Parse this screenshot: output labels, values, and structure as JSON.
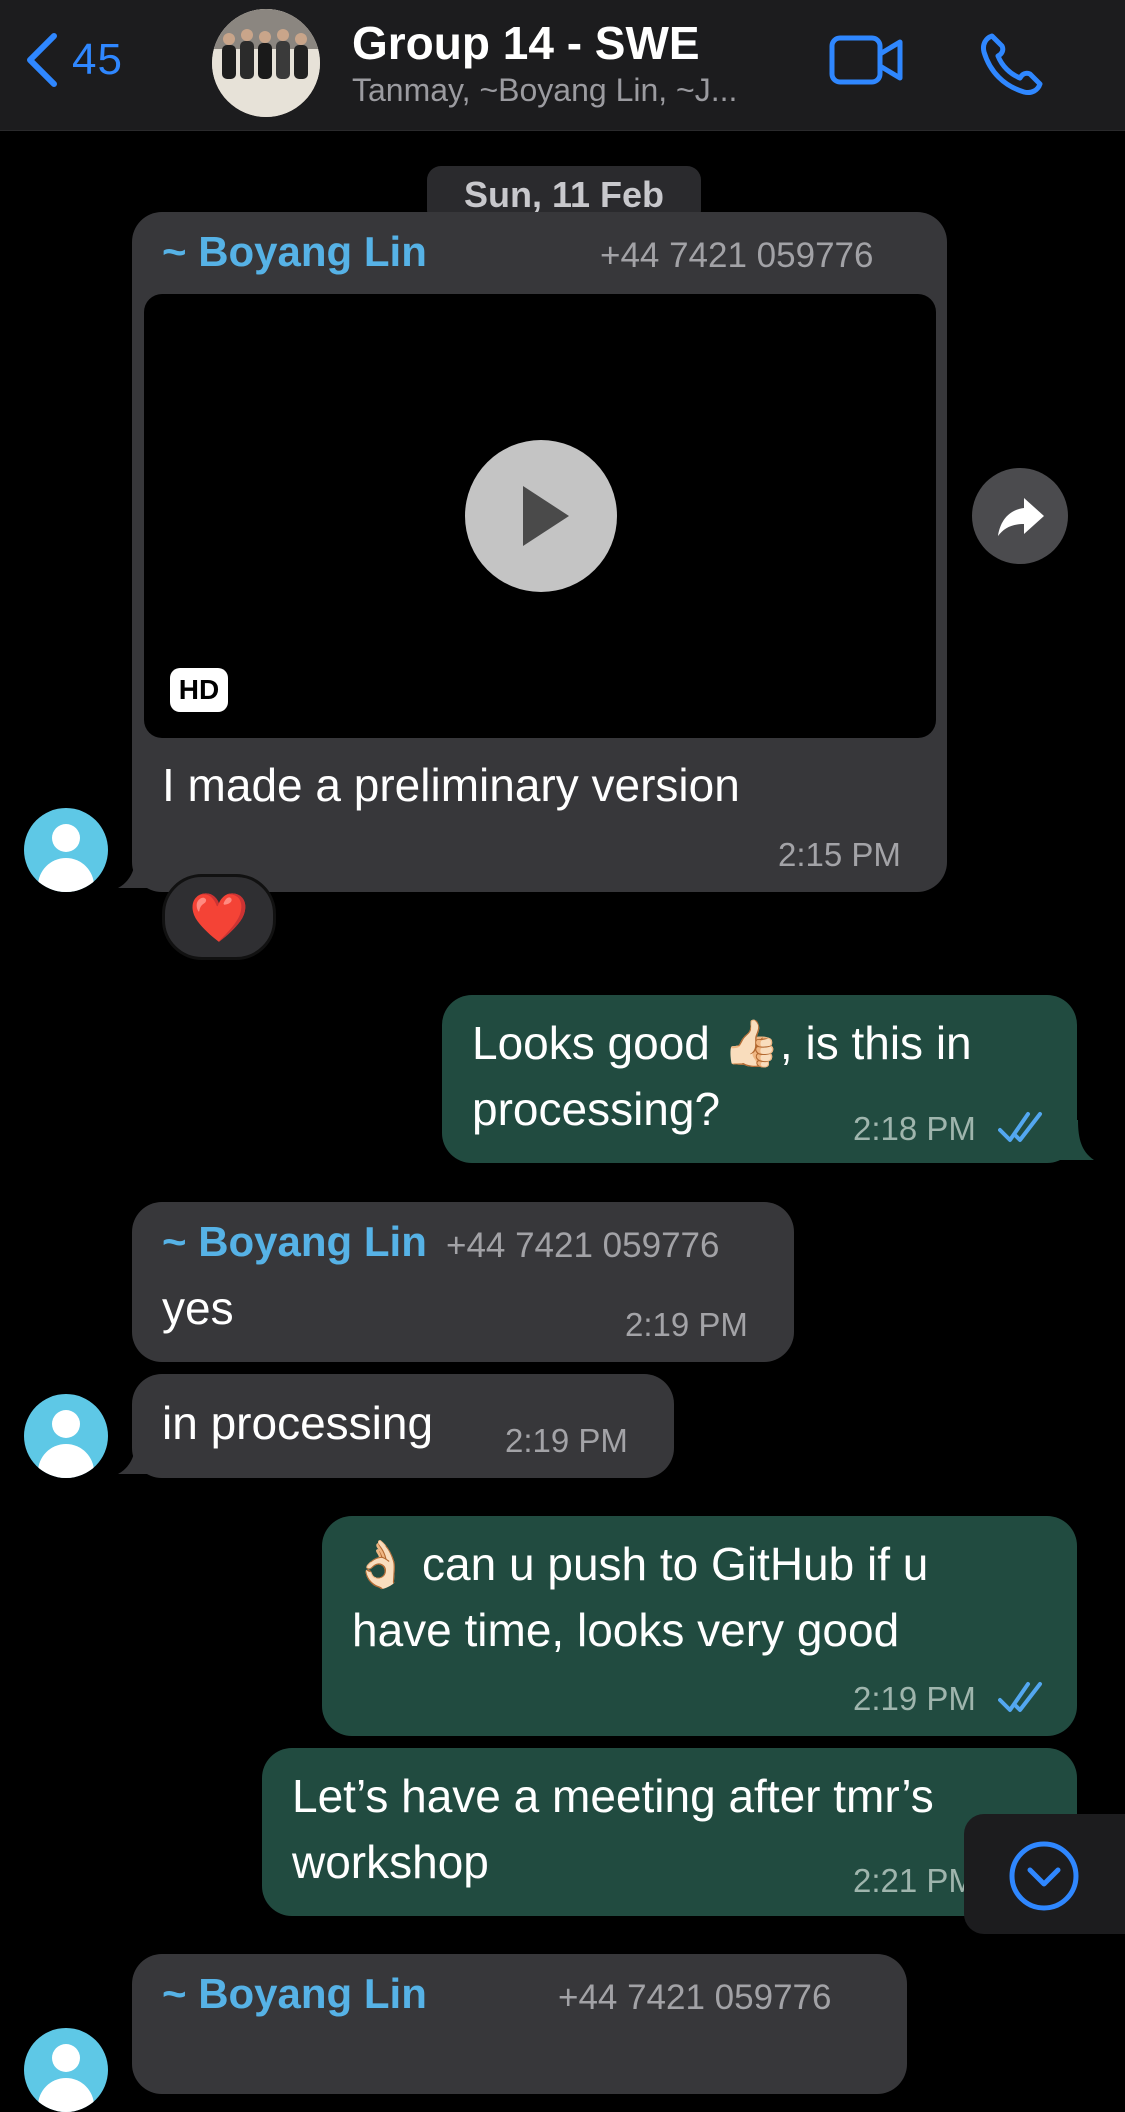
{
  "header": {
    "back_count": "45",
    "title": "Group 14 - SWE",
    "subtitle": "Tanmay, ~Boyang Lin, ~J..."
  },
  "date_label": "Sun, 11 Feb",
  "messages": [
    {
      "direction": "in",
      "sender": "~ Boyang Lin",
      "phone": "+44 7421 059776",
      "media": {
        "type": "video",
        "badge": "HD"
      },
      "text": "I made a preliminary version",
      "time": "2:15 PM",
      "reaction": "❤️"
    },
    {
      "direction": "out",
      "text_line1": "Looks good 👍🏻, is this in",
      "text_line2": "processing?",
      "time": "2:18 PM"
    },
    {
      "direction": "in",
      "sender": "~ Boyang Lin",
      "phone": "+44 7421 059776",
      "text": "yes",
      "time": "2:19 PM"
    },
    {
      "direction": "in",
      "text": "in processing",
      "time": "2:19 PM"
    },
    {
      "direction": "out",
      "text_line1": "👌🏻 can u push to GitHub if u",
      "text_line2": "have time, looks very good",
      "time": "2:19 PM"
    },
    {
      "direction": "out",
      "text_line1": "Let’s have a meeting after tmr’s",
      "text_line2": "workshop",
      "time": "2:21 PM"
    },
    {
      "direction": "in",
      "sender": "~ Boyang Lin",
      "phone": "+44 7421 059776"
    }
  ],
  "colors": {
    "accent": "#2f87ff",
    "incoming_bubble": "#37373a",
    "outgoing_bubble": "#214b40",
    "sender_name": "#56b2e6",
    "read_ticks": "#53a7f0"
  }
}
